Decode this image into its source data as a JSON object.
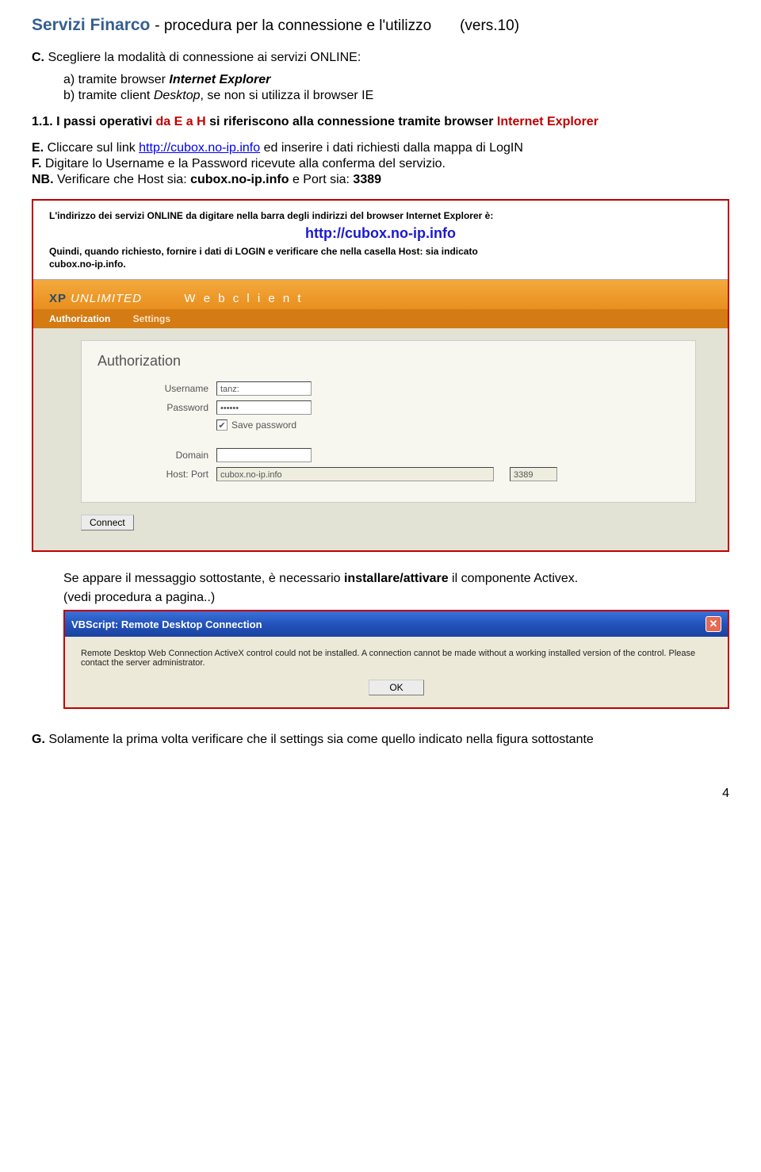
{
  "header": {
    "title_main": "Servizi Finarco",
    "title_dash": " - ",
    "title_sub": "procedura per la connessione  e l'utilizzo",
    "title_vers": "(vers.10)"
  },
  "section_c": {
    "prefix": "C.",
    "text": " Scegliere la modalità di connessione ai servizi ONLINE:"
  },
  "options": {
    "a_pre": "a) tramite browser ",
    "a_em": "Internet Explorer",
    "b_pre": "b) tramite client ",
    "b_em": "Desktop",
    "b_rest": ", se non si utilizza il browser IE"
  },
  "step11": {
    "num": "1.1.",
    "pre": "   I passi operativi ",
    "red1": "da E a H",
    "mid": " si riferiscono alla connessione tramite browser ",
    "red2": "Internet Explorer"
  },
  "stepE": {
    "prefix": "E.",
    "pre": " Cliccare sul link ",
    "link": "http://cubox.no-ip.info",
    "post": " ed inserire i dati richiesti dalla mappa di LogIN"
  },
  "stepF": {
    "prefix": "F.",
    "line1": " Digitare lo Username e la Password ricevute alla conferma del servizio.",
    "nb_label": "NB.",
    "nb_rest": " Verificare che Host sia: ",
    "nb_host": "cubox.no-ip.info",
    "nb_and": " e Port sia: ",
    "nb_port": "3389"
  },
  "ss1": {
    "intro": "L'indirizzo dei servizi ONLINE da digitare nella barra degli indirizzi del browser Internet Explorer è:",
    "url": "http://cubox.no-ip.info",
    "quindi1": "Quindi, quando richiesto, fornire i dati di LOGIN e verificare che nella casella Host: sia indicato",
    "quindi2": "cubox.no-ip.info.",
    "logo_xp": "XP",
    "logo_rest": " UNLIMITED",
    "logo_wc": "W e b c l i e n t",
    "tab_auth": "Authorization",
    "tab_settings": "Settings",
    "form_title": "Authorization",
    "lbl_user": "Username",
    "lbl_pass": "Password",
    "lbl_save": "Save password",
    "lbl_domain": "Domain",
    "lbl_hostport": "Host: Port",
    "val_user": "tanz:",
    "val_pass": "••••••",
    "val_host": "cubox.no-ip.info",
    "val_port": "3389",
    "check_mark": "✔",
    "btn_connect": "Connect"
  },
  "after_ss1": {
    "line_pre": "Se appare  il messaggio sottostante, è necessario ",
    "line_bold": "installare/attivare",
    "line_post": "  il componente Activex.",
    "small": "(vedi procedura a pagina..)"
  },
  "ss2": {
    "title": "VBScript: Remote Desktop Connection",
    "body": "Remote Desktop Web Connection ActiveX control could not be installed. A connection cannot be made without a working installed version of the control. Please contact the server administrator.",
    "ok": "OK"
  },
  "stepG": {
    "prefix": "G.",
    "text": " Solamente la prima volta verificare che il settings sia come quello indicato nella figura sottostante"
  },
  "page_num": "4"
}
